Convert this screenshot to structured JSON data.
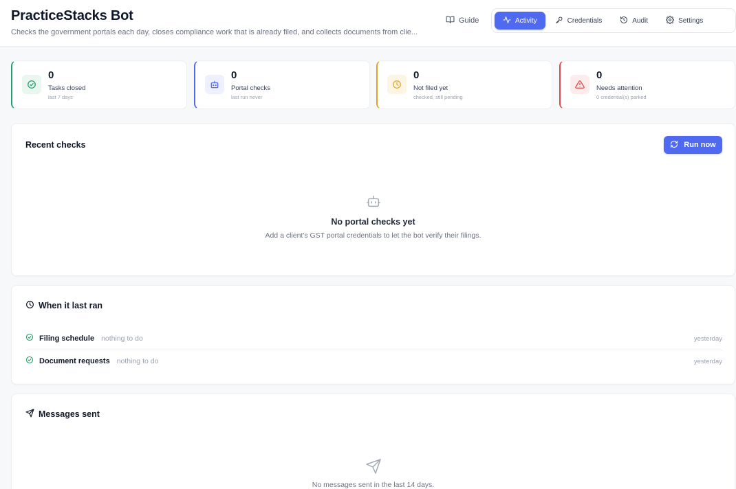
{
  "header": {
    "title": "PracticeStacks Bot",
    "subtitle": "Checks the government portals each day, closes compliance work that is already filed, and collects documents from clie...",
    "guide_label": "Guide",
    "tabs": [
      {
        "label": "Activity",
        "icon": "activity-icon",
        "active": true
      },
      {
        "label": "Credentials",
        "icon": "key-icon",
        "active": false
      },
      {
        "label": "Audit",
        "icon": "history-icon",
        "active": false
      },
      {
        "label": "Settings",
        "icon": "gear-icon",
        "active": false
      }
    ]
  },
  "stats": [
    {
      "value": "0",
      "label": "Tasks closed",
      "sub": "last 7 days",
      "icon": "check-circle-icon",
      "color": "#22a06b"
    },
    {
      "value": "0",
      "label": "Portal checks",
      "sub": "last run never",
      "icon": "bot-icon",
      "color": "#4f6af0"
    },
    {
      "value": "0",
      "label": "Not filed yet",
      "sub": "checked, still pending",
      "icon": "clock-icon",
      "color": "#e0a526"
    },
    {
      "value": "0",
      "label": "Needs attention",
      "sub": "0 credential(s) parked",
      "icon": "warning-icon",
      "color": "#e0474c"
    }
  ],
  "recent_checks": {
    "title": "Recent checks",
    "run_now_label": "Run now",
    "empty_title": "No portal checks yet",
    "empty_text": "Add a client's GST portal credentials to let the bot verify their filings."
  },
  "last_ran": {
    "title": "When it last ran",
    "rows": [
      {
        "name": "Filing schedule",
        "status": "nothing to do",
        "when": "yesterday"
      },
      {
        "name": "Document requests",
        "status": "nothing to do",
        "when": "yesterday"
      }
    ]
  },
  "messages": {
    "title": "Messages sent",
    "empty_text": "No messages sent in the last 14 days."
  },
  "colors": {
    "accent": "#4f6af0",
    "success": "#22a06b",
    "warning": "#e0a526",
    "danger": "#e0474c"
  }
}
